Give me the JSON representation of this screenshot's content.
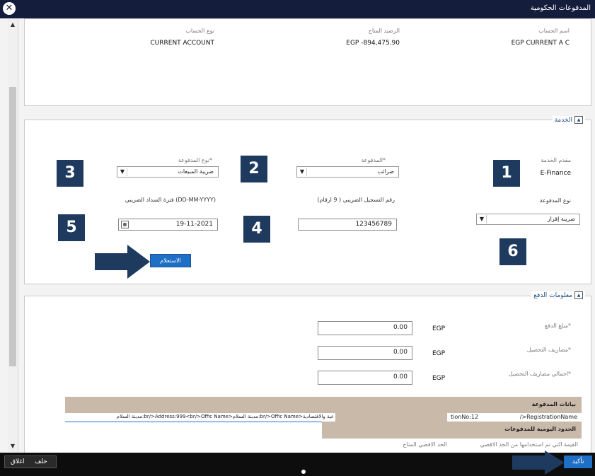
{
  "window": {
    "title": "المدفوعات الحكومية"
  },
  "account": {
    "name_label": "اسم الحساب",
    "name_value": "EGP CURRENT A C",
    "balance_label": "الرصيد المتاح",
    "balance_value": "EGP -894,475.90",
    "type_label": "نوع الحساب",
    "type_value": "CURRENT ACCOUNT"
  },
  "service": {
    "legend": "الخدمة",
    "provider_label": "مقدم الخدمة",
    "provider_value": "E-Finance",
    "payment_type_label": "نوع المدفوعة",
    "payment_type_value": "ضريبة إقرار",
    "payment_label": "المدفوعة*",
    "payment_value": "ضرائب",
    "payment_kind_label": "نوع المدفوعة*",
    "payment_kind_value": "ضريبة المبيعات",
    "tax_reg_label": "رقم التسجيل الضريبي ( 9 ارقام)",
    "tax_reg_value": "123456789",
    "tax_period_label": "فترة السداد الضريبي (DD-MM-YYYY)",
    "tax_period_value": "19-11-2021",
    "inquiry_button": "الاستعلام"
  },
  "payment_info": {
    "legend": "معلومات الدفع",
    "amount_label": "مبلغ الدفع*",
    "amount_value": "0.00",
    "fees_label": "مصاريف التحصيل*",
    "fees_value": "0.00",
    "total_fees_label": "اجمالي مصاريف التحصيل*",
    "total_fees_value": "0.00",
    "currency": "EGP"
  },
  "payment_details": {
    "header": "بيانات المدفوعة",
    "line_right": "/>RegistrationName",
    "line_mid": "tionNo:12",
    "line_left": "عية والاقتصادية<br/>Offic Name:مدينة السلام<br/>Address:999<br/>Offic Name:مدينة السلام",
    "daily_limits_header": "الحدود اليومية للمدفوعات",
    "used_label": "القيمة التي تم استخدامها من الحد الاقصي",
    "remaining_label": "الحد الاقصي المتاح"
  },
  "bottom": {
    "confirm": "تأكيد",
    "back": "خلف",
    "close": "اغلاق"
  },
  "annotations": [
    "1",
    "2",
    "3",
    "4",
    "5",
    "6"
  ],
  "colors": {
    "titlebar": "#141d3b",
    "annotation_box": "#1f3a5f",
    "button": "#1f6fc5",
    "band": "#c9b9a9"
  }
}
